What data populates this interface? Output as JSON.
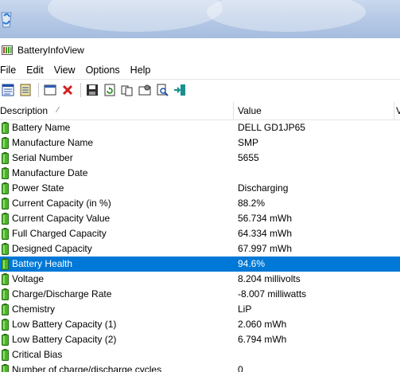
{
  "window": {
    "title": "BatteryInfoView"
  },
  "menu": [
    "File",
    "Edit",
    "View",
    "Options",
    "Help"
  ],
  "toolbar": {
    "buttons": [
      {
        "icon": "properties-icon"
      },
      {
        "icon": "html-report-icon"
      },
      {
        "icon": "window-icon"
      },
      {
        "icon": "delete-icon"
      },
      {
        "icon": "save-icon"
      },
      {
        "icon": "refresh-icon"
      },
      {
        "icon": "copy-icon"
      },
      {
        "icon": "options-icon"
      },
      {
        "icon": "find-icon"
      },
      {
        "icon": "exit-icon"
      }
    ]
  },
  "table": {
    "headers": {
      "description": "Description",
      "value": "Value",
      "more": "V"
    },
    "rows": [
      {
        "description": "Battery Name",
        "value": "DELL GD1JP65"
      },
      {
        "description": "Manufacture Name",
        "value": "SMP"
      },
      {
        "description": "Serial Number",
        "value": "5655"
      },
      {
        "description": "Manufacture Date",
        "value": ""
      },
      {
        "description": "Power State",
        "value": "Discharging"
      },
      {
        "description": "Current Capacity (in %)",
        "value": "88.2%"
      },
      {
        "description": "Current Capacity Value",
        "value": "56.734 mWh"
      },
      {
        "description": "Full Charged Capacity",
        "value": "64.334 mWh"
      },
      {
        "description": "Designed Capacity",
        "value": "67.997 mWh"
      },
      {
        "description": "Battery Health",
        "value": "94.6%"
      },
      {
        "description": "Voltage",
        "value": "8.204 millivolts"
      },
      {
        "description": "Charge/Discharge Rate",
        "value": "-8.007 milliwatts"
      },
      {
        "description": "Chemistry",
        "value": "LiP"
      },
      {
        "description": "Low Battery Capacity (1)",
        "value": "2.060 mWh"
      },
      {
        "description": "Low Battery Capacity (2)",
        "value": "6.794 mWh"
      },
      {
        "description": "Critical Bias",
        "value": ""
      },
      {
        "description": "Number of charge/discharge cycles",
        "value": "0"
      }
    ],
    "selected_row": "Battery Health"
  },
  "colors": {
    "selection": "#0078d7",
    "battery_green": "#3a9d23"
  }
}
